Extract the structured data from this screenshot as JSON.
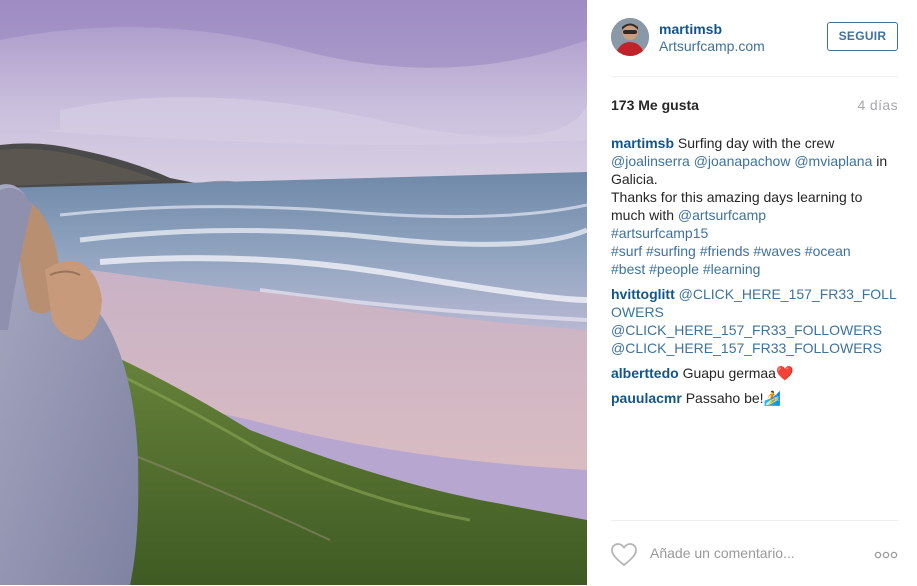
{
  "post": {
    "username": "martimsb",
    "location": "Artsurfcamp.com",
    "follow_label": "SEGUIR",
    "likes": "173 Me gusta",
    "age": "4 días",
    "photo_icon": "beach-photo"
  },
  "caption": {
    "author": "martimsb",
    "line1_text": " Surfing day with the crew",
    "mention1": "@joalinserra",
    "mention2": "@joanapachow",
    "mention3": "@mviaplana",
    "in_text": " in",
    "place": "Galicia.",
    "line4": "Thanks for this amazing days learning to",
    "line5_text": "much with ",
    "mention4": "@artsurfcamp",
    "tag1": "#artsurfcamp15",
    "tag2": "#surf",
    "tag3": "#surfing",
    "tag4": "#friends",
    "tag5": "#waves",
    "tag6": "#ocean",
    "tag7": "#best",
    "tag8": "#people",
    "tag9": "#learning"
  },
  "comments": [
    {
      "author": "hvittoglitt",
      "part1": "@CLICK_HERE_157_FR33_FOLL",
      "part2": "OWERS",
      "part3": "@CLICK_HERE_157_FR33_FOLLOWERS",
      "part4": "@CLICK_HERE_157_FR33_FOLLOWERS"
    },
    {
      "author": "alberttedo",
      "text": "Guapu germaa",
      "emoji": "❤️"
    },
    {
      "author": "pauulacmr",
      "text": "Passaho be!",
      "emoji": "🏄"
    }
  ],
  "footer": {
    "comment_placeholder": "Añade un comentario...",
    "heart_icon": "heart-outline-icon",
    "more_icon": "more-options-icon"
  },
  "colors": {
    "username": "#125688",
    "link": "#3f729b",
    "follow_border": "#3f729b",
    "muted": "#a5a7aa"
  }
}
